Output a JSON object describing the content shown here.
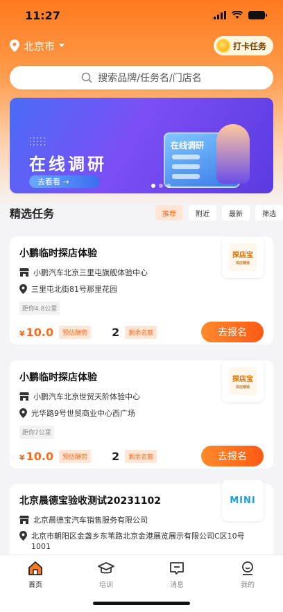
{
  "status": {
    "time": "11:27"
  },
  "header": {
    "city": "北京市",
    "checkin_label": "打卡任务"
  },
  "search": {
    "placeholder": "搜索品牌/任务名/门店名"
  },
  "banner": {
    "title": "在线调研",
    "button": "去看看 →",
    "card_title": "在线调研"
  },
  "section": {
    "title": "精选任务",
    "filters": [
      "推荐",
      "附近",
      "最新",
      "筛选"
    ]
  },
  "tasks": [
    {
      "title": "小鹏临时探店体验",
      "store": "小鹏汽车北京三里屯旗舰体验中心",
      "address": "三里屯北街81号那里花园",
      "distance": "距你4.8公里",
      "price_symbol": "¥",
      "price": "10.0",
      "price_tag": "预估酬劳",
      "quota": "2",
      "quota_tag": "剩余名额",
      "button": "去报名",
      "logo_text": "探店宝",
      "logo_sub": "探店赚钱"
    },
    {
      "title": "小鹏临时探店体验",
      "store": "小鹏汽车北京世贸天阶体验中心",
      "address": "光华路9号世贸商业中心西广场",
      "distance": "距你7公里",
      "price_symbol": "¥",
      "price": "10.0",
      "price_tag": "预估酬劳",
      "quota": "2",
      "quota_tag": "剩余名额",
      "button": "去报名",
      "logo_text": "探店宝",
      "logo_sub": "探店赚钱"
    },
    {
      "title": "北京晨德宝验收测试20231102",
      "store": "北京晨德宝汽车销售服务有限公司",
      "address": "北京市朝阳区金盏乡东苇路北京金港展览展示有限公司C区10号1001",
      "logo_text": "MINI"
    }
  ],
  "tabbar": {
    "items": [
      "首页",
      "培训",
      "消息",
      "我的"
    ]
  },
  "colors": {
    "accent": "#ff6a1a",
    "brand_orange": "#ff7a1e"
  }
}
